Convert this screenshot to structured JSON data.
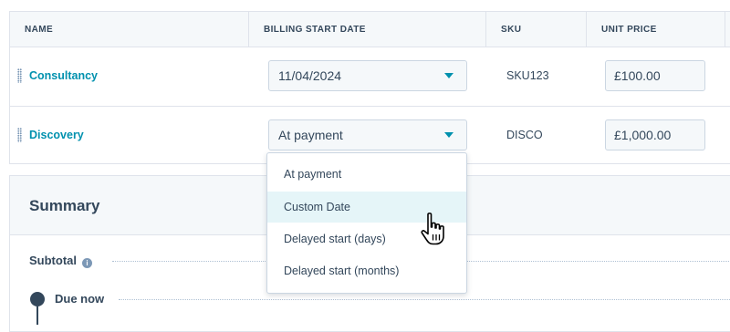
{
  "table": {
    "columns": [
      "NAME",
      "BILLING START DATE",
      "SKU",
      "UNIT PRICE"
    ],
    "rows": [
      {
        "name": "Consultancy",
        "billing_start": "11/04/2024",
        "sku": "SKU123",
        "unit_price": "£100.00"
      },
      {
        "name": "Discovery",
        "billing_start": "At payment",
        "sku": "DISCO",
        "unit_price": "£1,000.00"
      }
    ]
  },
  "dropdown": {
    "options": [
      "At payment",
      "Custom Date",
      "Delayed start (days)",
      "Delayed start (months)"
    ],
    "hovered_index": 1
  },
  "summary": {
    "title": "Summary",
    "subtotal_label": "Subtotal",
    "due_now_label": "Due now"
  },
  "colors": {
    "link": "#0091ae",
    "text": "#33475b",
    "border": "#dfe3eb",
    "header_bg": "#f5f8fa",
    "hover_bg": "#e5f5f8"
  },
  "icons": [
    "drag-handle-icon",
    "caret-down-icon",
    "info-icon",
    "hand-pointer-icon"
  ]
}
